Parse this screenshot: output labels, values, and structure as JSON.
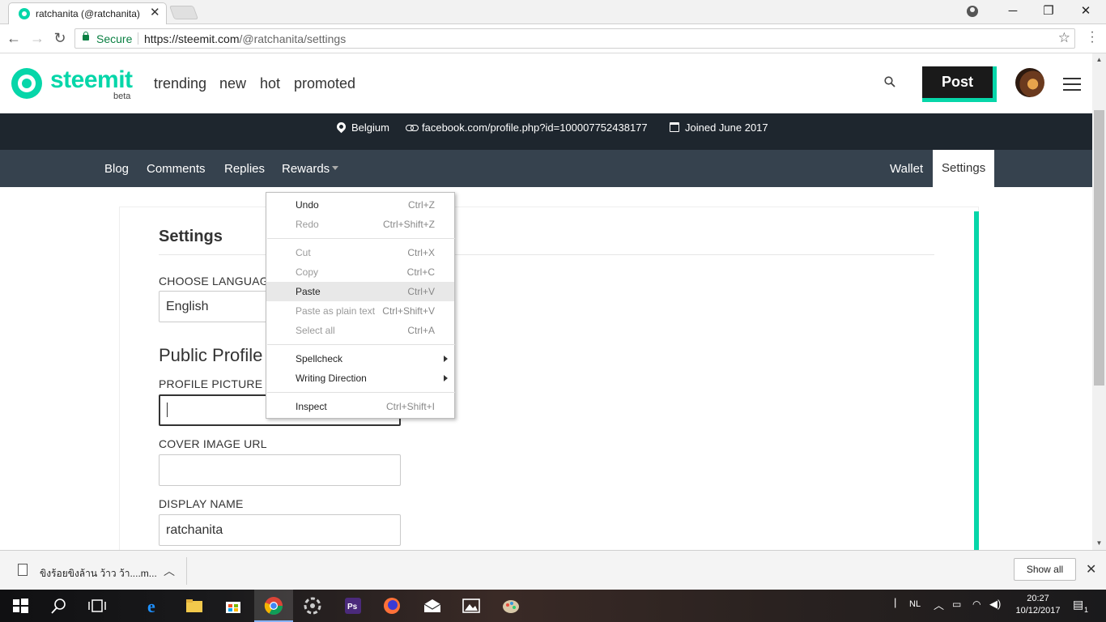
{
  "browser": {
    "tab_title": "ratchanita (@ratchanita)",
    "secure_label": "Secure",
    "url_base": "https://steemit.com",
    "url_path": "/@ratchanita/settings"
  },
  "site": {
    "logo_text": "steemit",
    "logo_sub": "beta",
    "nav": [
      "trending",
      "new",
      "hot",
      "promoted"
    ],
    "post_label": "Post",
    "accent_color": "#06d6a9"
  },
  "user": {
    "location": "Belgium",
    "website": "facebook.com/profile.php?id=100007752438177",
    "joined": "Joined June 2017"
  },
  "profile_tabs": {
    "left": [
      "Blog",
      "Comments",
      "Replies",
      "Rewards"
    ],
    "wallet": "Wallet",
    "settings": "Settings"
  },
  "settings": {
    "title": "Settings",
    "language_label": "CHOOSE LANGUAG",
    "language_value": "English",
    "public_profile_heading": "Public Profile",
    "profile_picture_label": "PROFILE PICTURE U",
    "profile_picture_value": "",
    "cover_image_label": "COVER IMAGE URL",
    "cover_image_value": "",
    "display_name_label": "DISPLAY NAME",
    "display_name_value": "ratchanita"
  },
  "context_menu": {
    "items": [
      {
        "label": "Undo",
        "shortcut": "Ctrl+Z",
        "enabled": true
      },
      {
        "label": "Redo",
        "shortcut": "Ctrl+Shift+Z",
        "enabled": false
      },
      {
        "label": "Cut",
        "shortcut": "Ctrl+X",
        "enabled": false
      },
      {
        "label": "Copy",
        "shortcut": "Ctrl+C",
        "enabled": false
      },
      {
        "label": "Paste",
        "shortcut": "Ctrl+V",
        "enabled": true,
        "highlighted": true
      },
      {
        "label": "Paste as plain text",
        "shortcut": "Ctrl+Shift+V",
        "enabled": false
      },
      {
        "label": "Select all",
        "shortcut": "Ctrl+A",
        "enabled": false
      },
      {
        "label": "Spellcheck",
        "submenu": true,
        "enabled": true
      },
      {
        "label": "Writing Direction",
        "submenu": true,
        "enabled": true
      },
      {
        "label": "Inspect",
        "shortcut": "Ctrl+Shift+I",
        "enabled": true
      }
    ]
  },
  "downloads": {
    "file_name": "ขิงร้อยขิงล้าน ว้าว ว้า....m...",
    "show_all": "Show all"
  },
  "taskbar": {
    "language": "NL",
    "time": "20:27",
    "date": "10/12/2017",
    "notifications": "1"
  }
}
